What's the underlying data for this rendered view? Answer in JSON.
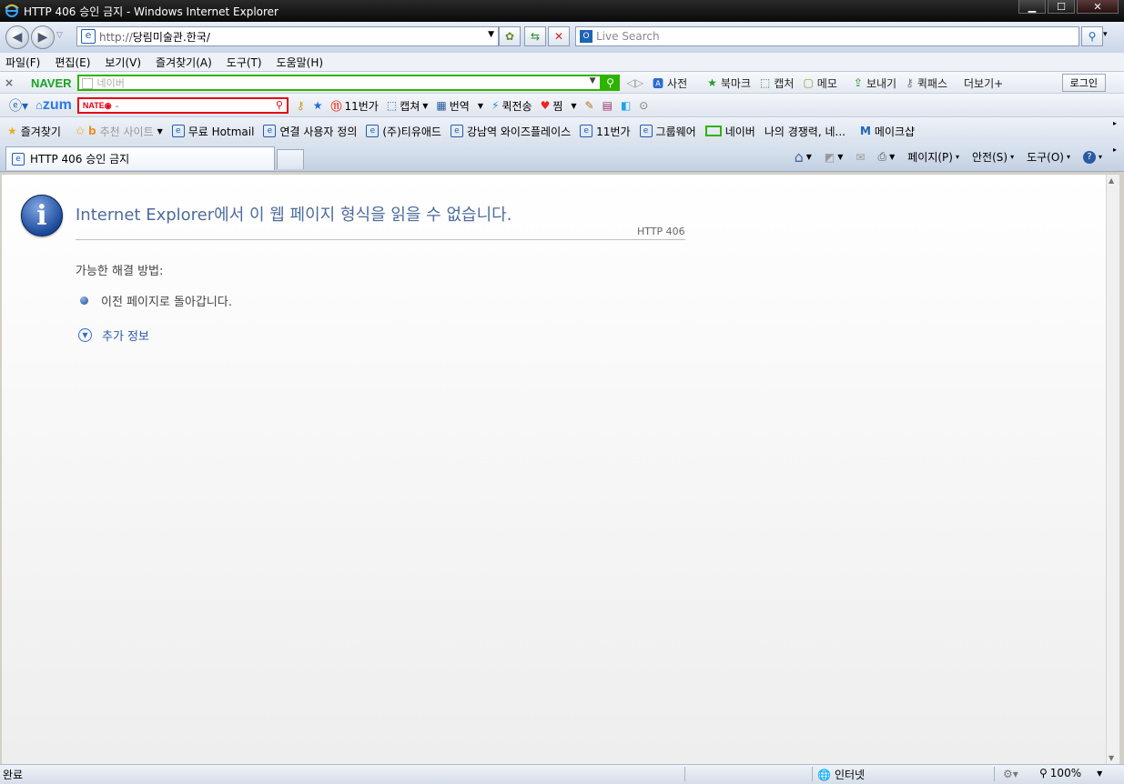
{
  "window": {
    "title": "HTTP 406 승인 금지 - Windows Internet Explorer",
    "minimize": "▁",
    "maximize": "☐",
    "close": "✕"
  },
  "address": {
    "url_prefix": "http://",
    "url_host": "당림미술관.한국/",
    "search_placeholder": "Live Search"
  },
  "menu": [
    "파일(F)",
    "편집(E)",
    "보기(V)",
    "즐겨찾기(A)",
    "도구(T)",
    "도움말(H)"
  ],
  "naver_toolbar": {
    "logo": "NAVER",
    "search_placeholder": "네이버",
    "items": [
      "사전",
      "북마크",
      "캡처",
      "메모",
      "보내기",
      "퀵패스",
      "더보기+"
    ],
    "login": "로그인"
  },
  "zum_toolbar": {
    "logo": "zum",
    "nate_logo": "NATE◉",
    "nate_value": "-",
    "items": [
      "11번가",
      "캡쳐",
      "번역",
      "퀵전송",
      "찜"
    ]
  },
  "favorites": {
    "label": "즐겨찾기",
    "items": [
      "추천 사이트",
      "무료 Hotmail",
      "연결 사용자 정의",
      "(주)티유애드",
      "강남역 와이즈플레이스",
      "11번가",
      "그룹웨어",
      "네이버",
      "나의 경쟁력, 네...",
      "메이크샵"
    ]
  },
  "tab": {
    "title": "HTTP 406 승인 금지"
  },
  "commands": {
    "page": "페이지(P)",
    "safety": "안전(S)",
    "tools": "도구(O)"
  },
  "error_page": {
    "heading": "Internet Explorer에서 이 웹 페이지 형식을 읽을 수 없습니다.",
    "code": "HTTP 406",
    "solutions_label": "가능한 해결 방법:",
    "solution_1": "이전 페이지로 돌아갑니다.",
    "more_info": "추가 정보"
  },
  "status": {
    "text": "완료",
    "zone": "인터넷",
    "zoom": "100%"
  }
}
